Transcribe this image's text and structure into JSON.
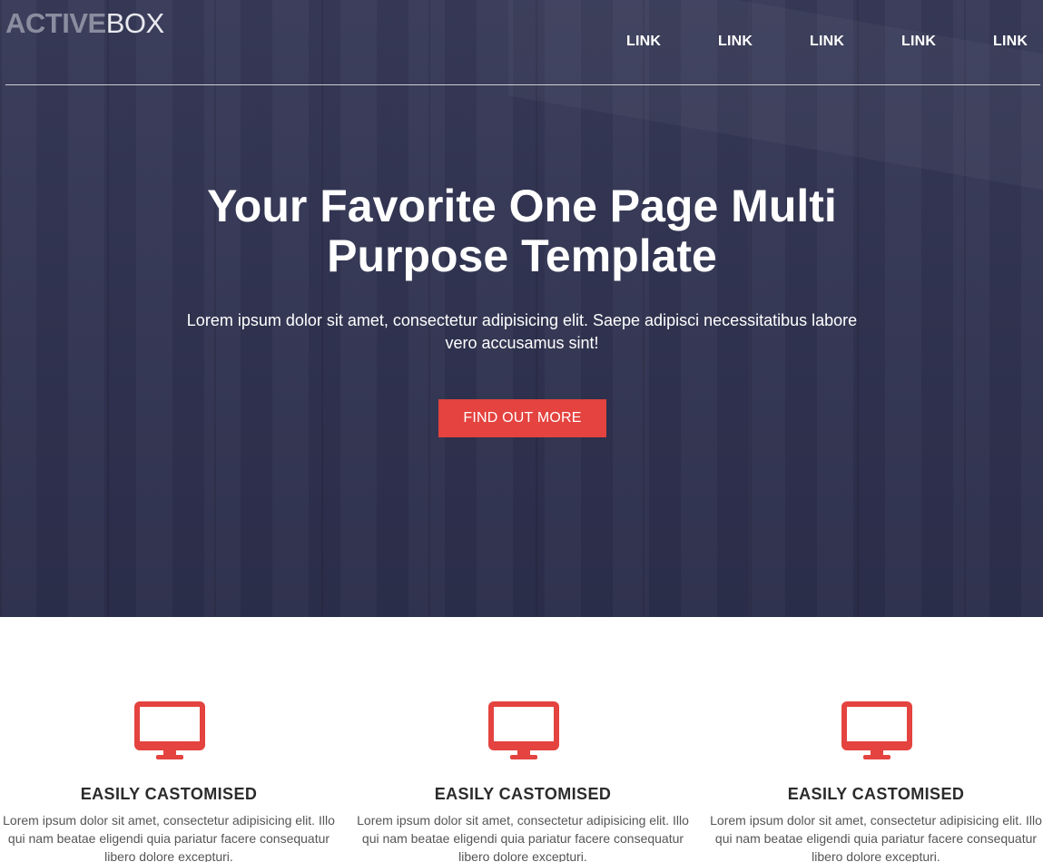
{
  "header": {
    "logo_bold": "ACTIVE",
    "logo_light": "BOX",
    "nav": [
      "LINK",
      "LINK",
      "LINK",
      "LINK",
      "LINK"
    ]
  },
  "hero": {
    "title": "Your Favorite One Page Multi Purpose Template",
    "subtitle": "Lorem ipsum dolor sit amet, consectetur adipisicing elit. Saepe adipisci necessitatibus labore vero accusamus sint!",
    "cta_label": "FIND OUT MORE"
  },
  "features": [
    {
      "icon": "monitor-icon",
      "title": "EASILY CASTOMISED",
      "text": "Lorem ipsum dolor sit amet, consectetur adipisicing elit. Illo qui nam beatae eligendi quia pariatur facere consequatur libero dolore excepturi."
    },
    {
      "icon": "monitor-icon",
      "title": "EASILY CASTOMISED",
      "text": "Lorem ipsum dolor sit amet, consectetur adipisicing elit. Illo qui nam beatae eligendi quia pariatur facere consequatur libero dolore excepturi."
    },
    {
      "icon": "monitor-icon",
      "title": "EASILY CASTOMISED",
      "text": "Lorem ipsum dolor sit amet, consectetur adipisicing elit. Illo qui nam beatae eligendi quia pariatur facere consequatur libero dolore excepturi."
    }
  ],
  "colors": {
    "hero_background": "#2f3251",
    "accent": "#e4433f",
    "text_light": "#ffffff",
    "heading_dark": "#2b2b2b",
    "body_text": "#555555"
  }
}
